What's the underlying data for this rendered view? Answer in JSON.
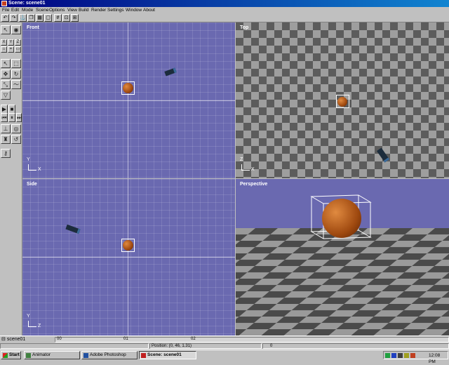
{
  "window": {
    "title": "Scene: scene01"
  },
  "menu": [
    "File",
    "Edit",
    "Mode",
    "Scene",
    "Options",
    "View",
    "Build",
    "Render",
    "Settings",
    "Window",
    "About"
  ],
  "palette": {
    "axis_x": "X",
    "axis_y": "Y",
    "axis_z": "Z"
  },
  "viewports": {
    "front": {
      "label": "Front",
      "axis_v": "Y",
      "axis_h": "X"
    },
    "top": {
      "label": "Top",
      "axis_v": "Z",
      "axis_h": "X"
    },
    "side": {
      "label": "Side",
      "axis_v": "Y",
      "axis_h": "Z"
    },
    "perspective": {
      "label": "Perspective"
    }
  },
  "timeline": {
    "scene": "scene01",
    "ticks": [
      "00",
      "01",
      "02"
    ]
  },
  "status": {
    "position": "Position: (0, 46, 1.31)",
    "frame": "0"
  },
  "taskbar": {
    "start": "Start",
    "tasks": [
      "Animator",
      "Adobe Photoshop",
      "Scene: scene01"
    ],
    "clock": "12:08 PM"
  },
  "colors": {
    "viewport_blue": "#6a69b0",
    "title_bar": "#000080",
    "ball": "#c0682a"
  }
}
